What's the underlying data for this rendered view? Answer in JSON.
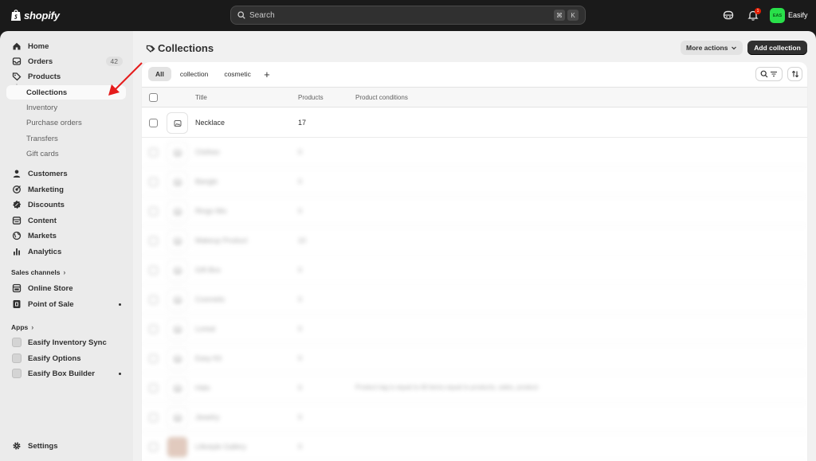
{
  "topbar": {
    "brand": "shopify",
    "search_placeholder": "Search",
    "shortcut_keys": [
      "⌘",
      "K"
    ],
    "notification_count": "1",
    "store_initials": "EAS",
    "store_name": "Easify"
  },
  "sidebar": {
    "items": [
      {
        "label": "Home",
        "icon": "home-icon"
      },
      {
        "label": "Orders",
        "icon": "inbox-icon",
        "count": "42"
      },
      {
        "label": "Products",
        "icon": "tag-icon"
      },
      {
        "label": "Collections",
        "active": true
      },
      {
        "label": "Inventory"
      },
      {
        "label": "Purchase orders"
      },
      {
        "label": "Transfers"
      },
      {
        "label": "Gift cards"
      },
      {
        "label": "Customers",
        "icon": "person-icon"
      },
      {
        "label": "Marketing",
        "icon": "target-icon"
      },
      {
        "label": "Discounts",
        "icon": "discount-icon"
      },
      {
        "label": "Content",
        "icon": "content-icon"
      },
      {
        "label": "Markets",
        "icon": "globe-icon"
      },
      {
        "label": "Analytics",
        "icon": "bar-chart-icon"
      }
    ],
    "sales_channels_label": "Sales channels",
    "sales_channels": [
      {
        "label": "Online Store",
        "icon": "store-icon"
      },
      {
        "label": "Point of Sale",
        "icon": "pos-icon"
      }
    ],
    "apps_label": "Apps",
    "apps": [
      {
        "label": "Easify Inventory Sync"
      },
      {
        "label": "Easify Options"
      },
      {
        "label": "Easify Box Builder"
      }
    ],
    "settings_label": "Settings"
  },
  "page": {
    "title": "Collections",
    "more_actions": "More actions",
    "add_collection": "Add collection"
  },
  "tabs": [
    "All",
    "collection",
    "cosmetic"
  ],
  "table": {
    "columns": [
      "Title",
      "Products",
      "Product conditions"
    ],
    "rows": [
      {
        "title": "Necklace",
        "products": "17",
        "conditions": ""
      },
      {
        "title": "Clothes",
        "products": "0",
        "conditions": ""
      },
      {
        "title": "Bangle",
        "products": "0",
        "conditions": ""
      },
      {
        "title": "Rings Mix",
        "products": "0",
        "conditions": ""
      },
      {
        "title": "Makeup Product",
        "products": "10",
        "conditions": ""
      },
      {
        "title": "Gift Box",
        "products": "0",
        "conditions": ""
      },
      {
        "title": "Cosmetic",
        "products": "0",
        "conditions": ""
      },
      {
        "title": "Loreal",
        "products": "0",
        "conditions": ""
      },
      {
        "title": "Easy Kit",
        "products": "0",
        "conditions": ""
      },
      {
        "title": "Hats",
        "products": "0",
        "conditions": "Product tag is equal to All items equal to products, sales, product"
      },
      {
        "title": "Jewelry",
        "products": "0",
        "conditions": ""
      },
      {
        "title": "Lifestyle Gallery",
        "products": "0",
        "conditions": ""
      }
    ]
  },
  "colors": {
    "topbar": "#1a1a1a",
    "sidebar": "#ebebeb",
    "primary_button": "#303030",
    "annotation_arrow": "#e51c1c",
    "store_avatar": "#29e04a"
  }
}
